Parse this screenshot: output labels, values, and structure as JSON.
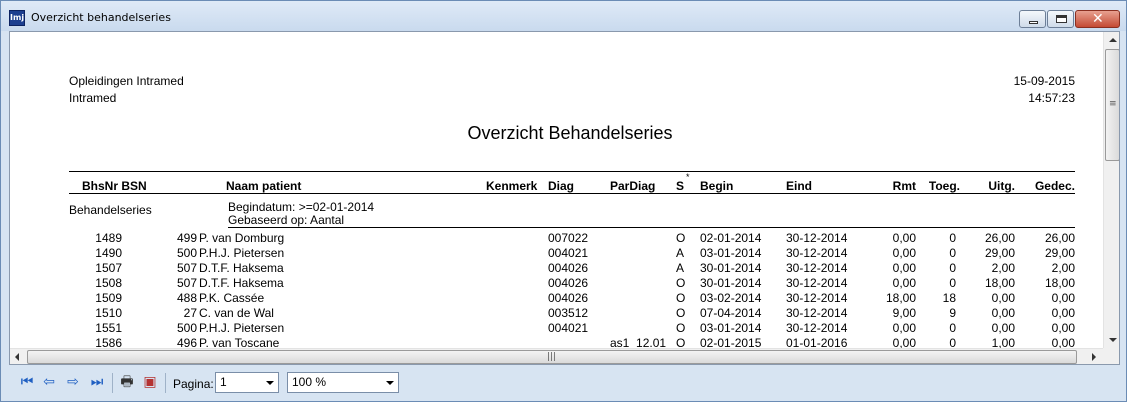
{
  "window": {
    "title": "Overzicht behandelseries",
    "icon_text": "Imj"
  },
  "report": {
    "org_line1": "Opleidingen Intramed",
    "org_line2": "Intramed",
    "date": "15-09-2015",
    "time": "14:57:23",
    "title": "Overzicht Behandelseries",
    "columns": {
      "bhsnr_bsn": "BhsNr BSN",
      "naam": "Naam patient",
      "kenmerk": "Kenmerk",
      "diag": "Diag",
      "pardiag": "ParDiag",
      "s": "S",
      "s_mark": "*",
      "begin": "Begin",
      "eind": "Eind",
      "rmt": "Rmt",
      "toeg": "Toeg.",
      "uitg": "Uitg.",
      "gedec": "Gedec."
    },
    "group_label": "Behandelseries",
    "filter_line1": "Begindatum: >=02-01-2014",
    "filter_line2": "Gebaseerd op: Aantal",
    "rows": [
      {
        "bhsnr": "1489",
        "bsn": "499",
        "naam": "P. van Domburg",
        "diag": "007022",
        "pardiag": "",
        "s": "O",
        "begin": "02-01-2014",
        "eind": "30-12-2014",
        "rmt": "0,00",
        "toeg": "0",
        "uitg": "26,00",
        "gedec": "26,00"
      },
      {
        "bhsnr": "1490",
        "bsn": "500",
        "naam": "P.H.J. Pietersen",
        "diag": "004021",
        "pardiag": "",
        "s": "A",
        "begin": "03-01-2014",
        "eind": "30-12-2014",
        "rmt": "0,00",
        "toeg": "0",
        "uitg": "29,00",
        "gedec": "29,00"
      },
      {
        "bhsnr": "1507",
        "bsn": "507",
        "naam": "D.T.F. Haksema",
        "diag": "004026",
        "pardiag": "",
        "s": "A",
        "begin": "30-01-2014",
        "eind": "30-12-2014",
        "rmt": "0,00",
        "toeg": "0",
        "uitg": "2,00",
        "gedec": "2,00"
      },
      {
        "bhsnr": "1508",
        "bsn": "507",
        "naam": "D.T.F. Haksema",
        "diag": "004026",
        "pardiag": "",
        "s": "O",
        "begin": "30-01-2014",
        "eind": "30-12-2014",
        "rmt": "0,00",
        "toeg": "0",
        "uitg": "18,00",
        "gedec": "18,00"
      },
      {
        "bhsnr": "1509",
        "bsn": "488",
        "naam": "P.K. Cassée",
        "diag": "004026",
        "pardiag": "",
        "s": "O",
        "begin": "03-02-2014",
        "eind": "30-12-2014",
        "rmt": "18,00",
        "toeg": "18",
        "uitg": "0,00",
        "gedec": "0,00"
      },
      {
        "bhsnr": "1510",
        "bsn": "27",
        "naam": "C. van de Wal",
        "diag": "003512",
        "pardiag": "",
        "s": "O",
        "begin": "07-04-2014",
        "eind": "30-12-2014",
        "rmt": "9,00",
        "toeg": "9",
        "uitg": "0,00",
        "gedec": "0,00"
      },
      {
        "bhsnr": "1551",
        "bsn": "500",
        "naam": "P.H.J. Pietersen",
        "diag": "004021",
        "pardiag": "",
        "s": "O",
        "begin": "03-01-2014",
        "eind": "30-12-2014",
        "rmt": "0,00",
        "toeg": "0",
        "uitg": "0,00",
        "gedec": "0,00"
      },
      {
        "bhsnr": "1586",
        "bsn": "496",
        "naam": "P. van Toscane",
        "diag": "",
        "pardiag": "as1_12.01",
        "s": "O",
        "begin": "02-01-2015",
        "eind": "01-01-2016",
        "rmt": "0,00",
        "toeg": "0",
        "uitg": "1,00",
        "gedec": "0,00"
      }
    ]
  },
  "toolbar": {
    "icons": [
      "first-page-icon",
      "previous-page-icon",
      "next-page-icon",
      "last-page-icon",
      "print-icon",
      "save-icon"
    ],
    "page_label": "Pagina:",
    "page_value": "1",
    "zoom_value": "100 %"
  }
}
